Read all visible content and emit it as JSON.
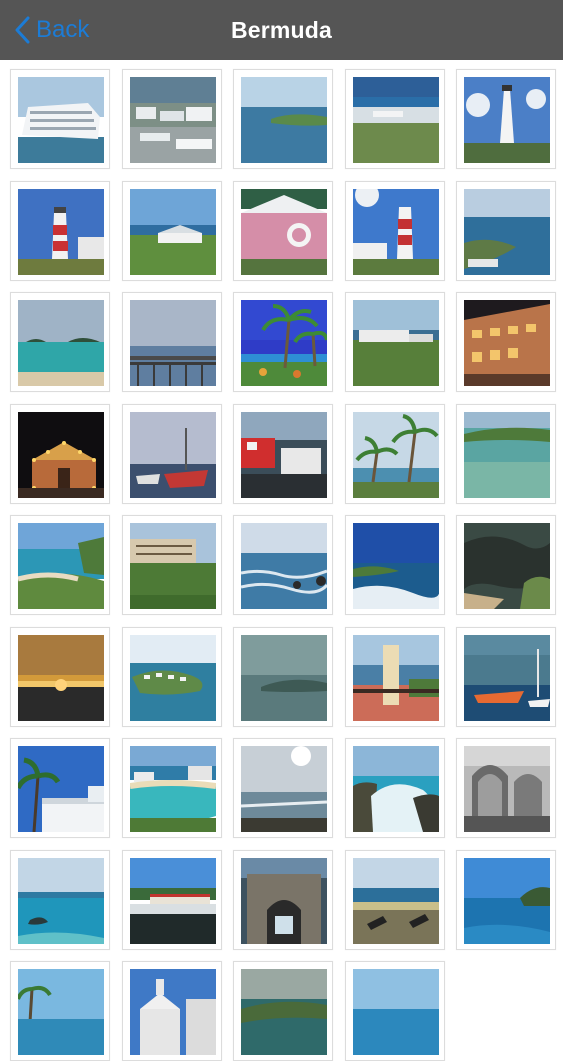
{
  "navbar": {
    "back_label": "Back",
    "title": "Bermuda",
    "accent_color": "#1c7cd6",
    "bar_color": "#555555"
  },
  "gallery": {
    "photos": [
      {
        "id": "cruise-ship"
      },
      {
        "id": "harbor-town"
      },
      {
        "id": "coastal-inlet"
      },
      {
        "id": "aerial-coast"
      },
      {
        "id": "white-lighthouse"
      },
      {
        "id": "red-white-lighthouse"
      },
      {
        "id": "ocean-lawn"
      },
      {
        "id": "pink-cottage"
      },
      {
        "id": "lighthouse-tower"
      },
      {
        "id": "rocky-point"
      },
      {
        "id": "turquoise-bay"
      },
      {
        "id": "pier-view"
      },
      {
        "id": "palm-trees-blue"
      },
      {
        "id": "hillside-building"
      },
      {
        "id": "lit-building-night"
      },
      {
        "id": "christmas-lights-house"
      },
      {
        "id": "boats-harbor"
      },
      {
        "id": "red-boat-dock"
      },
      {
        "id": "palms-shore"
      },
      {
        "id": "reef-lagoon"
      },
      {
        "id": "beach-cove"
      },
      {
        "id": "hotel-cliff"
      },
      {
        "id": "waves-rocks"
      },
      {
        "id": "surf-point"
      },
      {
        "id": "sea-cliffs"
      },
      {
        "id": "sunset-sea"
      },
      {
        "id": "island-town"
      },
      {
        "id": "misty-bay"
      },
      {
        "id": "fort-tower"
      },
      {
        "id": "ship-sunset"
      },
      {
        "id": "palm-house"
      },
      {
        "id": "beach-resort"
      },
      {
        "id": "sun-over-bay"
      },
      {
        "id": "crashing-wave"
      },
      {
        "id": "stone-ruins"
      },
      {
        "id": "clear-water"
      },
      {
        "id": "green-shore"
      },
      {
        "id": "fort-gate"
      },
      {
        "id": "fort-cannons"
      },
      {
        "id": "cliff-ocean"
      },
      {
        "id": "palm-sky"
      },
      {
        "id": "church-rooftop"
      },
      {
        "id": "hills-bay"
      },
      {
        "id": "sky-blue-water"
      }
    ]
  }
}
